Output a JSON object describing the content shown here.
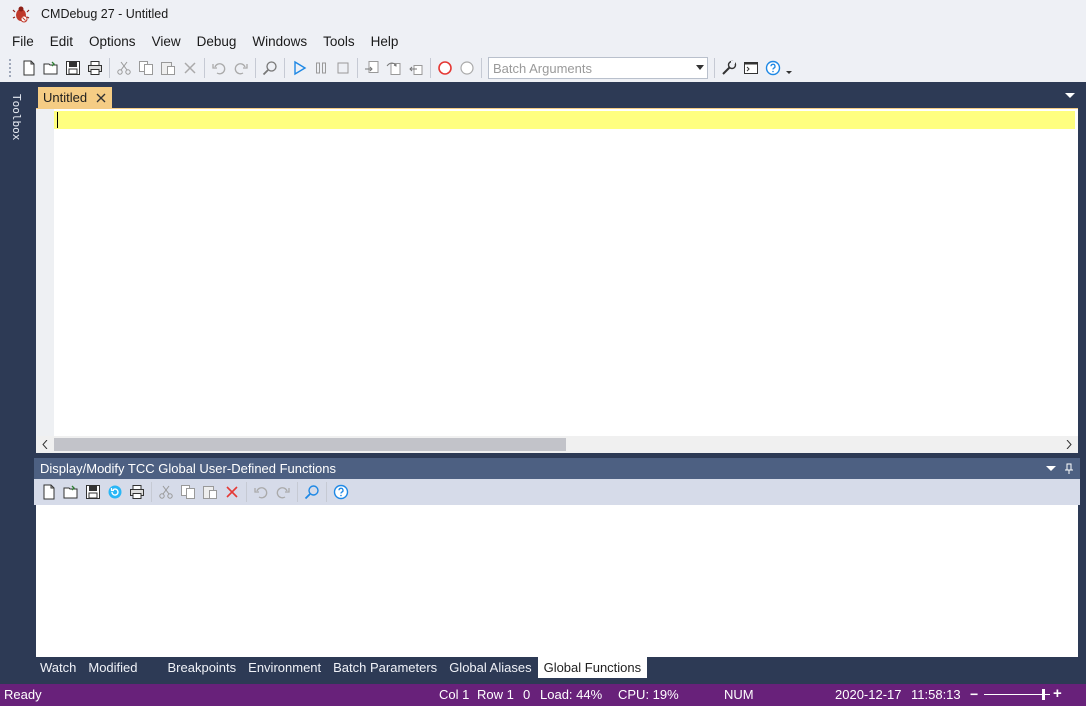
{
  "window": {
    "title": "CMDebug 27 - Untitled",
    "icon": "bug-icon"
  },
  "menu": [
    "File",
    "Edit",
    "Options",
    "View",
    "Debug",
    "Windows",
    "Tools",
    "Help"
  ],
  "toolbar": {
    "batch_arguments_placeholder": "Batch Arguments",
    "buttons": [
      "new-icon",
      "open-icon",
      "save-icon",
      "print-icon",
      "cut-icon",
      "copy-icon",
      "paste-icon",
      "delete-icon",
      "undo-icon",
      "redo-icon",
      "find-icon",
      "run-icon",
      "pause-icon",
      "stop-icon",
      "step-into-icon",
      "step-over-icon",
      "step-out-icon",
      "breakpoint-icon",
      "clear-breakpoint-icon",
      "settings-icon",
      "console-icon",
      "help-icon"
    ]
  },
  "toolbox": {
    "label": "Toolbox"
  },
  "editor": {
    "tab_label": "Untitled"
  },
  "panel": {
    "title": "Display/Modify TCC Global User-Defined Functions"
  },
  "bottom_tabs": [
    "Watch",
    "Modified",
    "Breakpoints",
    "Environment",
    "Batch Parameters",
    "Global Aliases",
    "Global Functions"
  ],
  "bottom_tabs_active": "Global Functions",
  "status": {
    "ready": "Ready",
    "col": "Col 1",
    "row": "Row 1",
    "zero": "0",
    "load": "Load: 44%",
    "cpu": "CPU: 19%",
    "num": "NUM",
    "date": "2020-12-17",
    "time": "11:58:13",
    "zoom_minus": "−",
    "zoom_plus": "+"
  },
  "colors": {
    "accent": "#68217a",
    "frame": "#2d3a55",
    "tab_active": "#f5cc84",
    "current_line": "#ffff80"
  }
}
